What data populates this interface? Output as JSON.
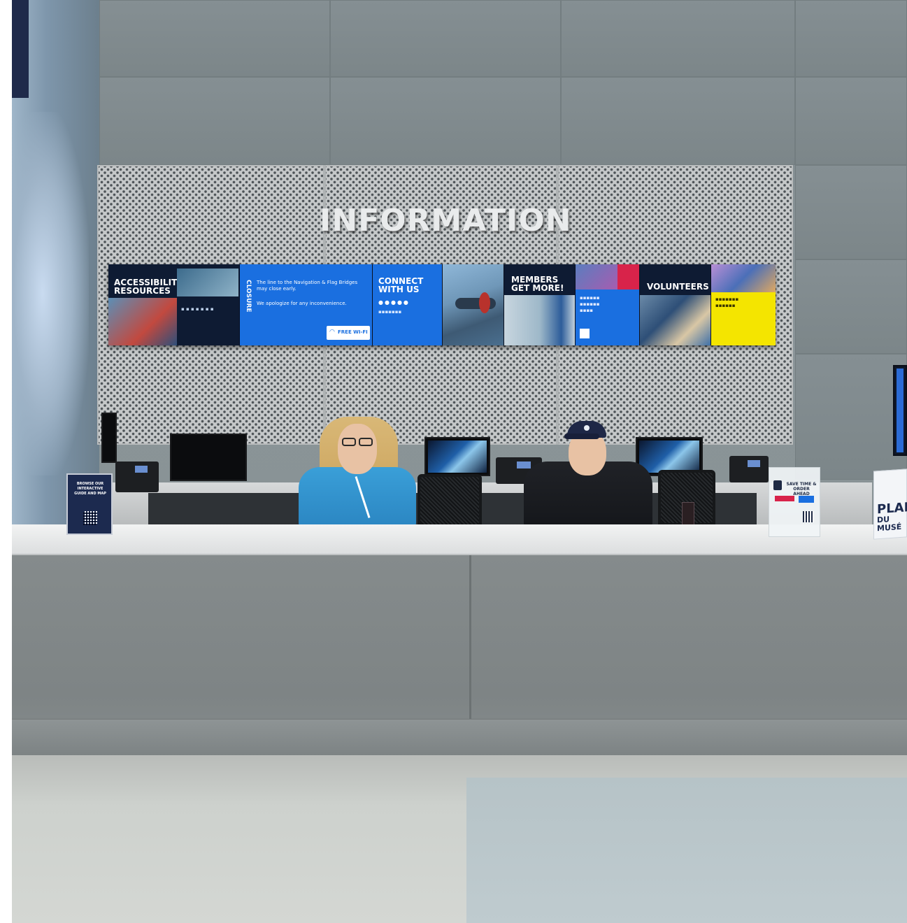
{
  "sign": {
    "main": "INFORMATION"
  },
  "screens": {
    "accessibility_title_1": "ACCESSIBILITY",
    "accessibility_title_2": "RESOURCES",
    "closure_title": "CLOSURE",
    "closure_line_1": "The line to the Navigation & Flag Bridges",
    "closure_line_2": "may close early.",
    "closure_line_3": "We apologize for any inconvenience.",
    "wifi_label": "FREE WI-FI",
    "connect_title_1": "CONNECT",
    "connect_title_2": "WITH US",
    "members_title_1": "MEMBERS",
    "members_title_2": "GET MORE!",
    "volunteers_title": "VOLUNTEERS"
  },
  "counter": {
    "qr_sign_1": "BROWSE OUR",
    "qr_sign_2": "INTERACTIVE",
    "qr_sign_3": "GUIDE AND MAP",
    "order_sign_1": "SAVE TIME &",
    "order_sign_2": "ORDER AHEAD",
    "brochure_1": "PLAN",
    "brochure_2": "DU MUSÉ"
  },
  "colors": {
    "screen_blue": "#1a6fe0",
    "screen_navy": "#0e1b33",
    "screen_yellow": "#f4e500",
    "screen_red": "#d8234a",
    "shirt_blue": "#3a9fd8"
  }
}
